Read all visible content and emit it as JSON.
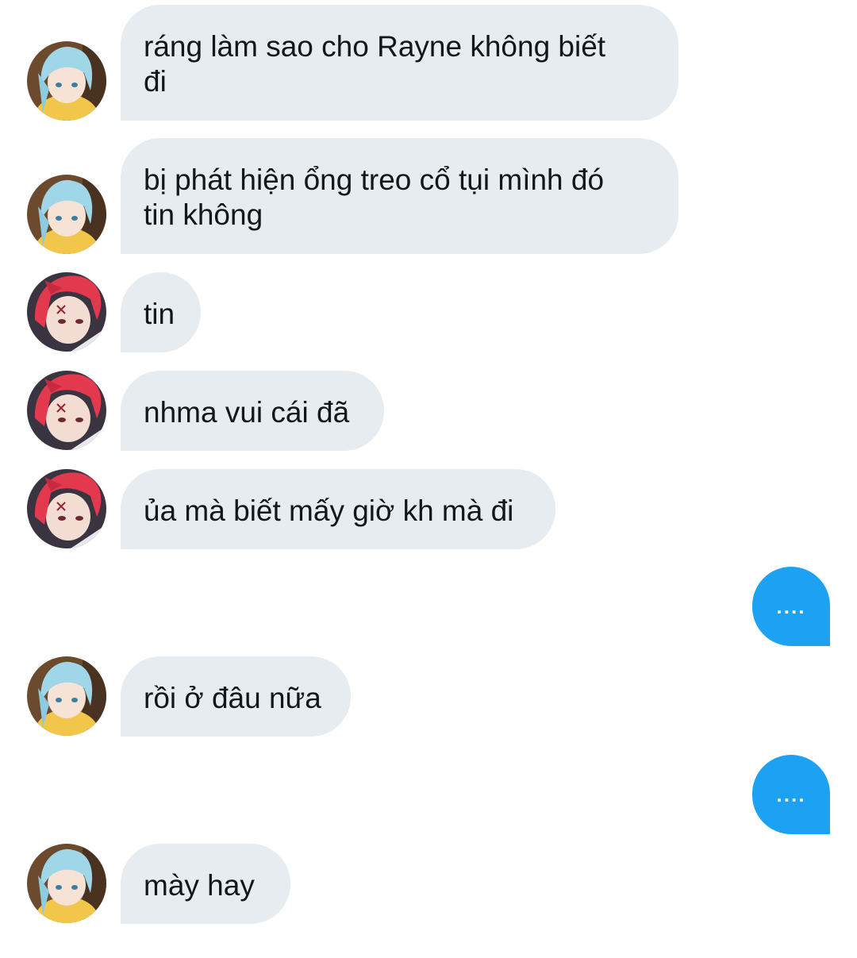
{
  "colors": {
    "incoming_bubble": "#e6ecf0",
    "outgoing_bubble": "#1da1f2",
    "incoming_text": "#14171a",
    "outgoing_text": "#ffffff"
  },
  "messages": [
    {
      "direction": "in",
      "sender_avatar": "blue-hair-avatar",
      "text": "ráng làm sao cho Rayne không biết\nđi"
    },
    {
      "direction": "in",
      "sender_avatar": "blue-hair-avatar",
      "text": "bị phát hiện ổng treo cổ tụi mình đó\ntin không"
    },
    {
      "direction": "in",
      "sender_avatar": "red-hair-avatar",
      "text": "tin"
    },
    {
      "direction": "in",
      "sender_avatar": "red-hair-avatar",
      "text": "nhma vui cái đã"
    },
    {
      "direction": "in",
      "sender_avatar": "red-hair-avatar",
      "text": "ủa mà biết mấy giờ kh mà đi"
    },
    {
      "direction": "out",
      "text": "...."
    },
    {
      "direction": "in",
      "sender_avatar": "blue-hair-avatar",
      "text": "rồi ở đâu nữa"
    },
    {
      "direction": "out",
      "text": "...."
    },
    {
      "direction": "in",
      "sender_avatar": "blue-hair-avatar",
      "text": "mày hay"
    }
  ]
}
